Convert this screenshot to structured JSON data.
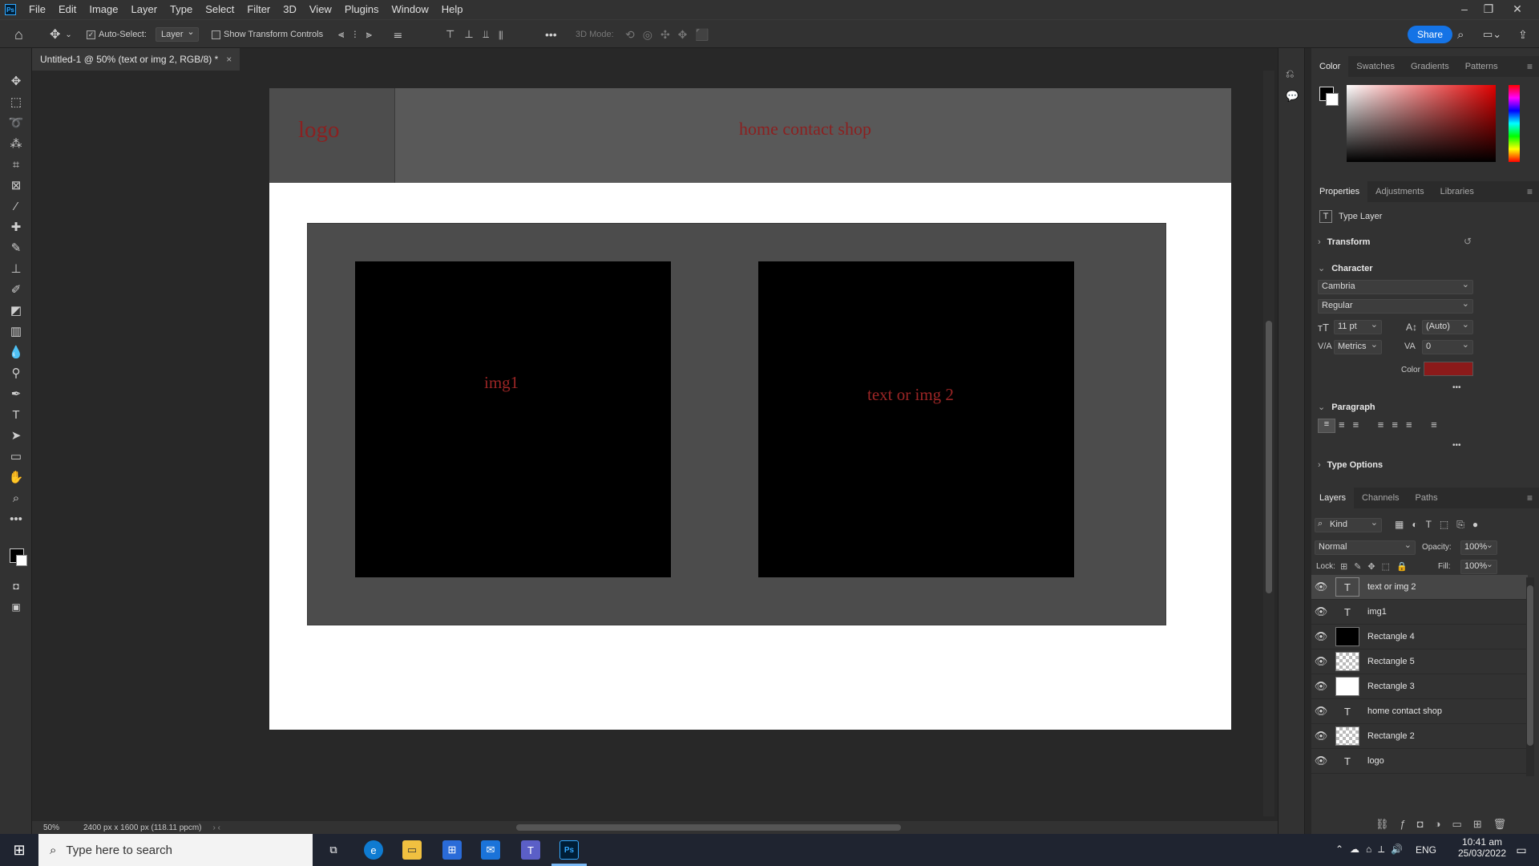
{
  "menubar": {
    "app_logo": "Ps",
    "items": [
      "File",
      "Edit",
      "Image",
      "Layer",
      "Type",
      "Select",
      "Filter",
      "3D",
      "View",
      "Plugins",
      "Window",
      "Help"
    ]
  },
  "options": {
    "auto_select_label": "Auto-Select:",
    "auto_select_value": "Layer",
    "show_transform_label": "Show Transform Controls",
    "mode_3d_label": "3D Mode:",
    "share_label": "Share"
  },
  "document": {
    "tab_title": "Untitled-1 @ 50% (text or img 2, RGB/8) *",
    "close_glyph": "×"
  },
  "canvas": {
    "logo_text": "logo",
    "nav_text": "home contact shop",
    "img1_text": "img1",
    "img2_text": "text or img 2"
  },
  "color_panel": {
    "tabs": [
      "Color",
      "Swatches",
      "Gradients",
      "Patterns"
    ]
  },
  "properties_panel": {
    "tabs": [
      "Properties",
      "Adjustments",
      "Libraries"
    ],
    "layer_type": "Type Layer",
    "transform_label": "Transform",
    "character_label": "Character",
    "font_family": "Cambria",
    "font_style": "Regular",
    "font_size": "11 pt",
    "leading": "(Auto)",
    "kerning": "Metrics",
    "tracking": "0",
    "color_label": "Color",
    "text_color": "#8b1a1a",
    "paragraph_label": "Paragraph",
    "type_options_label": "Type Options",
    "more_glyph": "•••"
  },
  "layers_panel": {
    "tabs": [
      "Layers",
      "Channels",
      "Paths"
    ],
    "filter_kind": "Kind",
    "blend_mode": "Normal",
    "opacity_label": "Opacity:",
    "opacity_value": "100%",
    "lock_label": "Lock:",
    "fill_label": "Fill:",
    "fill_value": "100%",
    "layers": [
      {
        "name": "text or img 2",
        "kind": "text",
        "selected": true
      },
      {
        "name": "img1",
        "kind": "text",
        "selected": false
      },
      {
        "name": "Rectangle 4",
        "kind": "shape",
        "selected": false
      },
      {
        "name": "Rectangle 5",
        "kind": "shape",
        "selected": false
      },
      {
        "name": "Rectangle 3",
        "kind": "shape",
        "selected": false
      },
      {
        "name": "home contact shop",
        "kind": "text",
        "selected": false
      },
      {
        "name": "Rectangle 2",
        "kind": "shape",
        "selected": false
      },
      {
        "name": "logo",
        "kind": "text",
        "selected": false
      }
    ]
  },
  "status": {
    "zoom": "50%",
    "doc_size": "2400 px x 1600 px (118.11 ppcm)"
  },
  "taskbar": {
    "search_placeholder": "Type here to search",
    "language": "ENG",
    "time": "10:41 am",
    "date": "25/03/2022"
  }
}
